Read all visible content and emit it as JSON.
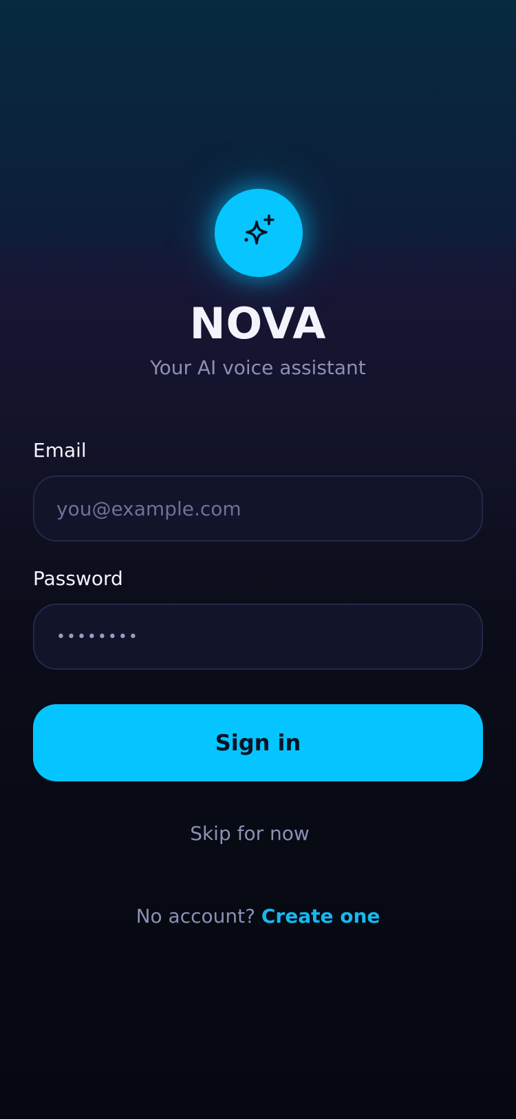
{
  "app": {
    "title": "NOVA",
    "subtitle": "Your AI voice assistant",
    "logo_icon": "sparkle-icon",
    "accent_color": "#06c5ff"
  },
  "form": {
    "email_label": "Email",
    "email_placeholder": "you@example.com",
    "email_value": "",
    "password_label": "Password",
    "password_value": "••••••••",
    "signin_label": "Sign in"
  },
  "skip_label": "Skip for now",
  "footer": {
    "prompt": "No account? ",
    "create_label": "Create one"
  }
}
